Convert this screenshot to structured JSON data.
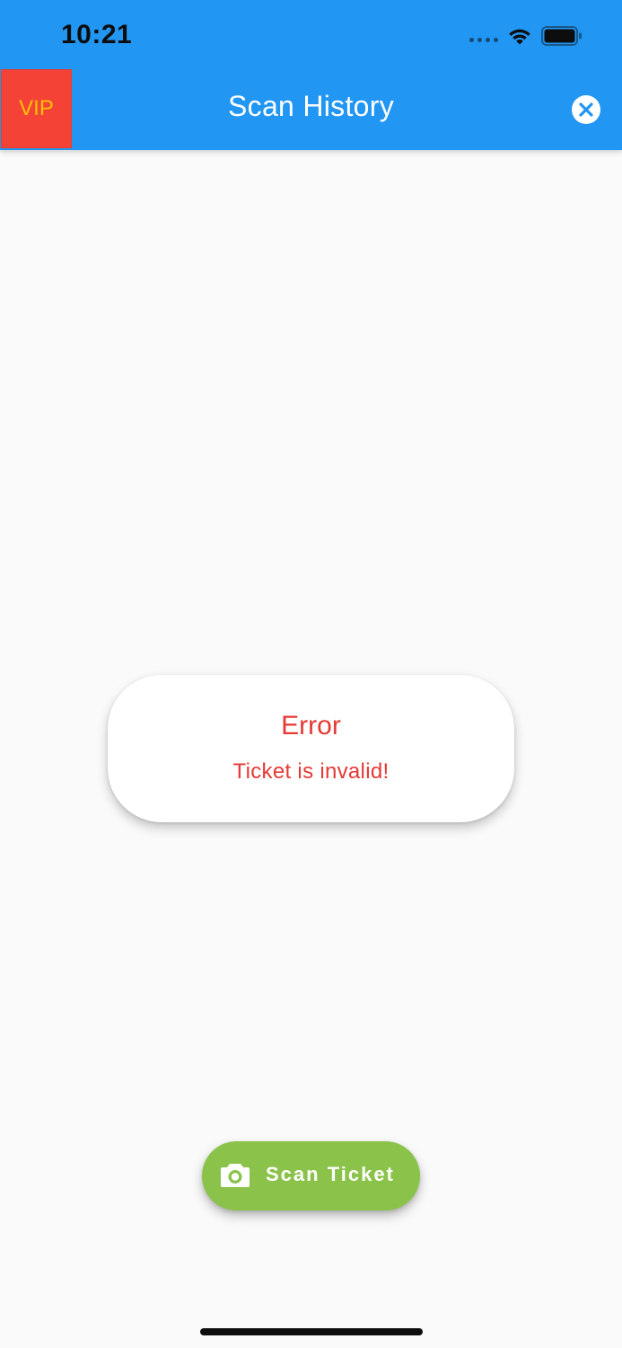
{
  "status_bar": {
    "time": "10:21"
  },
  "app_bar": {
    "title": "Scan History",
    "vip_label": "VIP",
    "close_icon": "close-circle-icon"
  },
  "error_dialog": {
    "title": "Error",
    "message": "Ticket is invalid!"
  },
  "fab": {
    "label": "Scan Ticket",
    "icon": "camera-icon"
  },
  "colors": {
    "app_bar": "#2196f3",
    "vip_background": "#f44336",
    "vip_text": "#ffc107",
    "error_text": "#e53935",
    "fab": "#8bc34a",
    "background": "#fafafa"
  }
}
